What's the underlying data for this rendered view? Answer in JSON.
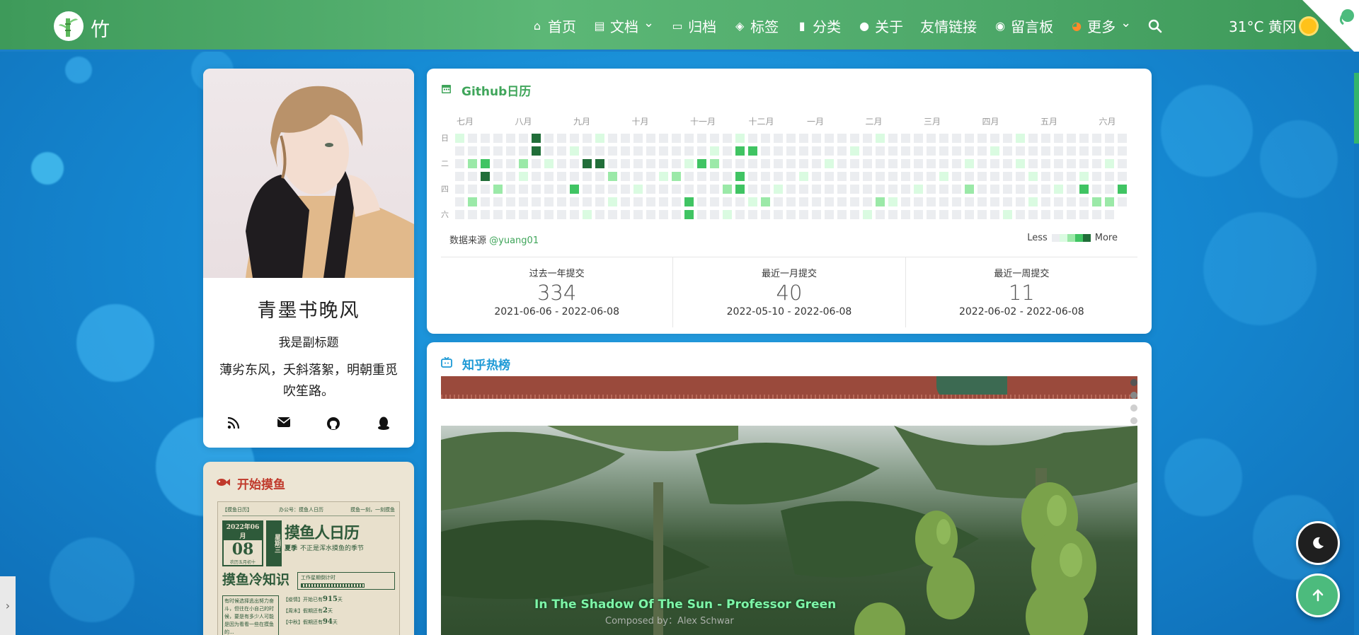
{
  "brand": {
    "name": "竹"
  },
  "nav": {
    "items": [
      {
        "label": "首页",
        "icon": "home-icon",
        "glyph": "⌂"
      },
      {
        "label": "文档",
        "icon": "document-icon",
        "glyph": "▤",
        "dropdown": true
      },
      {
        "label": "归档",
        "icon": "archive-icon",
        "glyph": "▭"
      },
      {
        "label": "标签",
        "icon": "tag-icon",
        "glyph": "◈"
      },
      {
        "label": "分类",
        "icon": "bookmark-icon",
        "glyph": "▮"
      },
      {
        "label": "关于",
        "icon": "user-icon",
        "glyph": "●"
      },
      {
        "label": "友情链接",
        "icon": "",
        "glyph": ""
      },
      {
        "label": "留言板",
        "icon": "comment-icon",
        "glyph": "◉"
      },
      {
        "label": "更多",
        "icon": "cat-emoji-icon",
        "glyph": "◕",
        "dropdown": true
      }
    ],
    "weather": "31°C 黄冈"
  },
  "profile": {
    "name": "青墨书晚风",
    "subtitle": "我是副标题",
    "motto": "薄劣东风，夭斜落絮，明朝重觅吹笙路。"
  },
  "moyu": {
    "title": "开始摸鱼",
    "poster": {
      "header_left": "【摸鱼日历】",
      "header_mid": "办公号：摸鱼人日历",
      "header_right": "摸鱼一刻，一刻摸鱼",
      "month": "2022年06月",
      "day": "08",
      "weekday": "星期三",
      "lunar": "农历五月初十",
      "big_title": "摸鱼人日历",
      "season": "夏季",
      "slogan": "不正是浑水摸鱼的季节",
      "section": "摸鱼冷知识",
      "countdown_title": "工作星期倒计时",
      "line1_tag": "【疫情】",
      "line1_text": "开始已有",
      "line1_num": "915",
      "line1_unit": "天",
      "line2_tag": "【周末】",
      "line2_text": "假期还有",
      "line2_num": "2",
      "line2_unit": "天",
      "line3_tag": "【中秋】",
      "line3_text": "假期还有",
      "line3_num": "94",
      "line3_unit": "天",
      "tip": "有时候选择逃出努力奋斗，但往在小自己的时候，要是有多少人可能是因为看看一些在摸鱼的..."
    }
  },
  "github": {
    "title": "Github日历",
    "months": [
      "七月",
      "八月",
      "九月",
      "十月",
      "十一月",
      "十二月",
      "一月",
      "二月",
      "三月",
      "四月",
      "五月",
      "六月"
    ],
    "weekdays": [
      "日",
      "",
      "二",
      "",
      "四",
      "",
      "六"
    ],
    "source_label": "数据来源",
    "source_user": "@yuang01",
    "legend_less": "Less",
    "legend_more": "More",
    "colors": [
      "#ebedf0",
      "#dafbe1",
      "#9be9a8",
      "#40c463",
      "#216e39"
    ],
    "stats": [
      {
        "label": "过去一年提交",
        "value": "334",
        "range": "2021-06-06 - 2022-06-08"
      },
      {
        "label": "最近一月提交",
        "value": "40",
        "range": "2022-05-10 - 2022-06-08"
      },
      {
        "label": "最近一周提交",
        "value": "11",
        "range": "2022-06-02 - 2022-06-08"
      }
    ]
  },
  "zhihu": {
    "title": "知乎热榜",
    "song": "In The Shadow Of The Sun - Professor Green",
    "composer": "Composed by：Alex Schwar"
  }
}
